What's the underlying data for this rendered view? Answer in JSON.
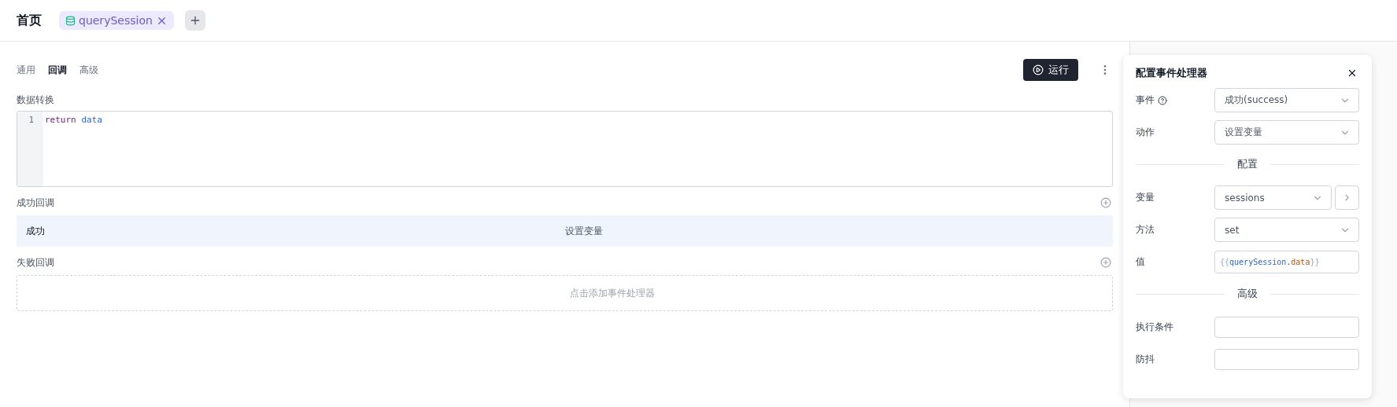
{
  "header": {
    "title": "首页",
    "tabs": [
      {
        "label": "querySession",
        "selected": true
      }
    ]
  },
  "tabs": [
    {
      "label": "通用",
      "selected": false
    },
    {
      "label": "回调",
      "selected": true
    },
    {
      "label": "高级",
      "selected": false
    }
  ],
  "run_button": "运行",
  "transform": {
    "label": "数据转换",
    "lines": [
      {
        "number": "1",
        "code": "return data"
      }
    ]
  },
  "success_callbacks": {
    "label": "成功回调",
    "rows": [
      {
        "event": "成功",
        "action": "设置变量",
        "selected": true
      }
    ]
  },
  "failure_callbacks": {
    "label": "失败回调",
    "placeholder": "点击添加事件处理器"
  },
  "dialog": {
    "title": "配置事件处理器",
    "fields": [
      {
        "kind": "select",
        "label": "事件",
        "help": true,
        "value": "成功(success)"
      },
      {
        "kind": "select",
        "label": "动作",
        "value": "设置变量"
      },
      {
        "kind": "divider",
        "label": "配置"
      },
      {
        "kind": "select",
        "label": "变量",
        "value": "sessions",
        "extra_button": true
      },
      {
        "kind": "select",
        "label": "方法",
        "value": "set"
      },
      {
        "kind": "code",
        "label": "值",
        "value": "{{querySession.data}}"
      },
      {
        "kind": "divider",
        "label": "高级"
      },
      {
        "kind": "input",
        "label": "执行条件"
      },
      {
        "kind": "input",
        "label": "防抖"
      }
    ]
  }
}
